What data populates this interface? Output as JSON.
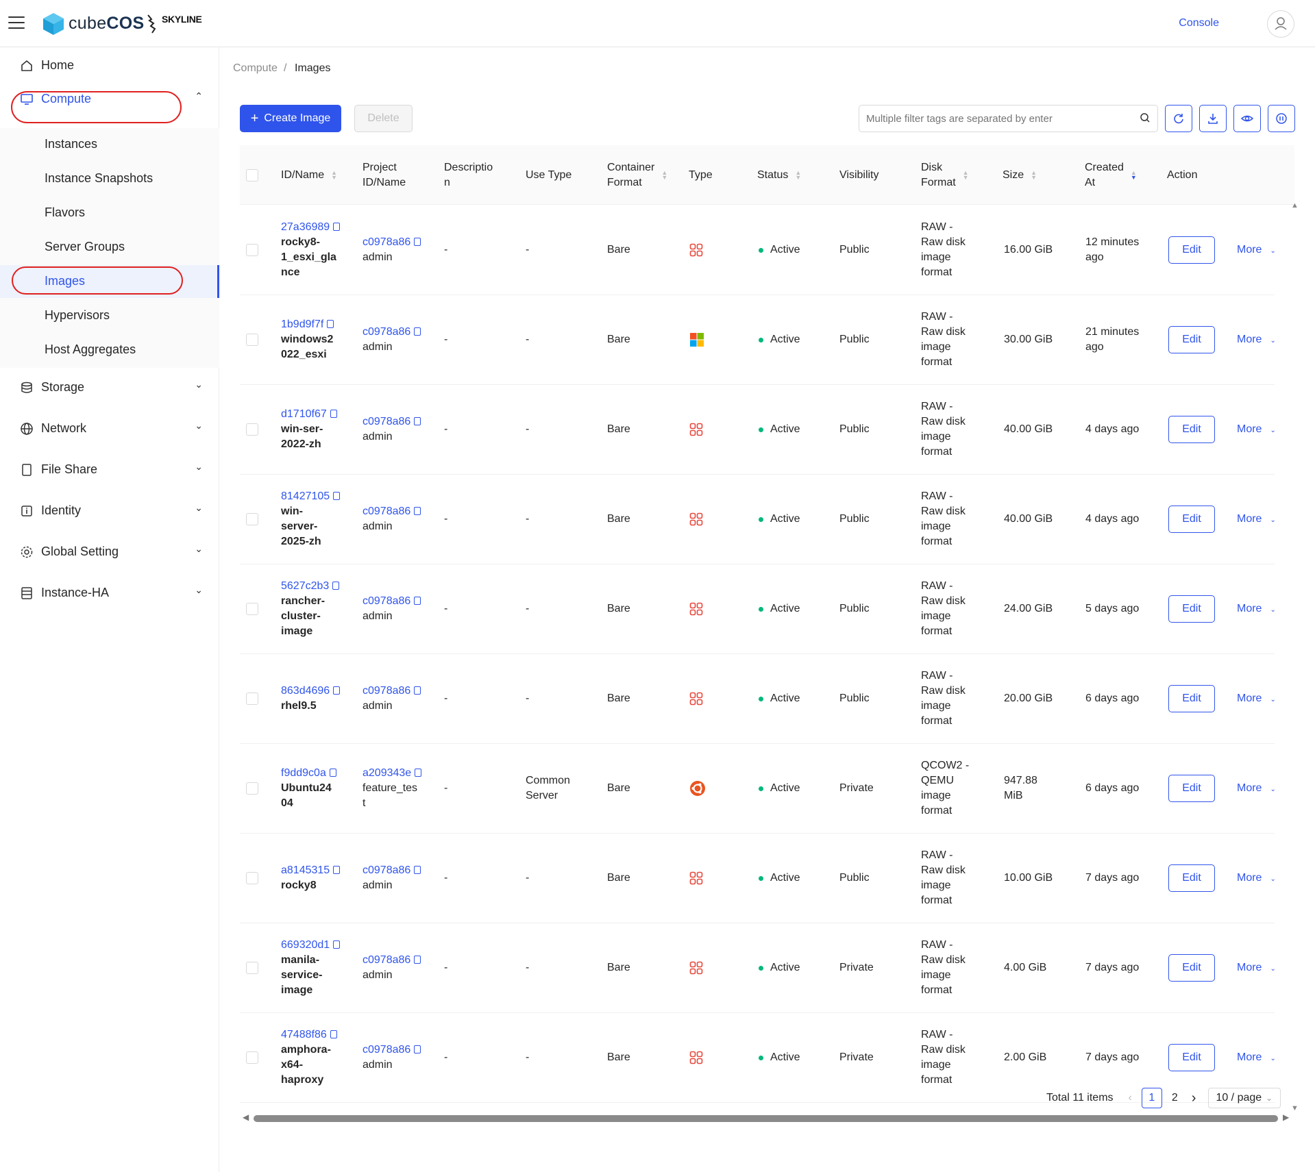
{
  "header": {
    "brand_light": "cube",
    "brand_bold": "COS",
    "partner": "SKYLINE",
    "console_label": "Console"
  },
  "sidebar": {
    "home": "Home",
    "compute": "Compute",
    "compute_children": [
      "Instances",
      "Instance Snapshots",
      "Flavors",
      "Server Groups",
      "Images",
      "Hypervisors",
      "Host Aggregates"
    ],
    "storage": "Storage",
    "network": "Network",
    "file_share": "File Share",
    "identity": "Identity",
    "global_setting": "Global Setting",
    "instance_ha": "Instance-HA",
    "active_item": "Images",
    "highlight_color": "#e02020"
  },
  "breadcrumb": {
    "parent": "Compute",
    "separator": "/",
    "current": "Images"
  },
  "toolbar": {
    "create_label": "Create Image",
    "delete_label": "Delete",
    "search_placeholder": "Multiple filter tags are separated by enter"
  },
  "columns": {
    "id_name": "ID/Name",
    "project_l1": "Project",
    "project_l2": "ID/Name",
    "desc_l1": "Descriptio",
    "desc_l2": "n",
    "use_type": "Use Type",
    "container_l1": "Container",
    "container_l2": "Format",
    "type": "Type",
    "status": "Status",
    "visibility": "Visibility",
    "disk_l1": "Disk",
    "disk_l2": "Format",
    "size": "Size",
    "created_l1": "Created",
    "created_l2": "At",
    "action": "Action"
  },
  "rows": [
    {
      "id": "27a36989",
      "name": [
        "rocky8-",
        "1_esxi_gla",
        "nce"
      ],
      "project_id": "c0978a86",
      "project": [
        "admin"
      ],
      "desc": "-",
      "use": [
        "-"
      ],
      "container": "Bare",
      "os": "generic",
      "status": "Active",
      "visibility": "Public",
      "disk": [
        "RAW -",
        "Raw disk",
        "image",
        "format"
      ],
      "size": [
        "16.00 GiB"
      ],
      "created": [
        "12 minutes",
        "ago"
      ],
      "edit": "Edit",
      "more": "More"
    },
    {
      "id": "1b9d9f7f",
      "name": [
        "windows2",
        "022_esxi"
      ],
      "project_id": "c0978a86",
      "project": [
        "admin"
      ],
      "desc": "-",
      "use": [
        "-"
      ],
      "container": "Bare",
      "os": "windows",
      "status": "Active",
      "visibility": "Public",
      "disk": [
        "RAW -",
        "Raw disk",
        "image",
        "format"
      ],
      "size": [
        "30.00 GiB"
      ],
      "created": [
        "21 minutes",
        "ago"
      ],
      "edit": "Edit",
      "more": "More"
    },
    {
      "id": "d1710f67",
      "name": [
        "win-ser-",
        "2022-zh"
      ],
      "project_id": "c0978a86",
      "project": [
        "admin"
      ],
      "desc": "-",
      "use": [
        "-"
      ],
      "container": "Bare",
      "os": "generic",
      "status": "Active",
      "visibility": "Public",
      "disk": [
        "RAW -",
        "Raw disk",
        "image",
        "format"
      ],
      "size": [
        "40.00 GiB"
      ],
      "created": [
        "4 days ago"
      ],
      "edit": "Edit",
      "more": "More"
    },
    {
      "id": "81427105",
      "name": [
        "win-",
        "server-",
        "2025-zh"
      ],
      "project_id": "c0978a86",
      "project": [
        "admin"
      ],
      "desc": "-",
      "use": [
        "-"
      ],
      "container": "Bare",
      "os": "generic",
      "status": "Active",
      "visibility": "Public",
      "disk": [
        "RAW -",
        "Raw disk",
        "image",
        "format"
      ],
      "size": [
        "40.00 GiB"
      ],
      "created": [
        "4 days ago"
      ],
      "edit": "Edit",
      "more": "More"
    },
    {
      "id": "5627c2b3",
      "name": [
        "rancher-",
        "cluster-",
        "image"
      ],
      "project_id": "c0978a86",
      "project": [
        "admin"
      ],
      "desc": "-",
      "use": [
        "-"
      ],
      "container": "Bare",
      "os": "generic",
      "status": "Active",
      "visibility": "Public",
      "disk": [
        "RAW -",
        "Raw disk",
        "image",
        "format"
      ],
      "size": [
        "24.00 GiB"
      ],
      "created": [
        "5 days ago"
      ],
      "edit": "Edit",
      "more": "More"
    },
    {
      "id": "863d4696",
      "name": [
        "rhel9.5"
      ],
      "project_id": "c0978a86",
      "project": [
        "admin"
      ],
      "desc": "-",
      "use": [
        "-"
      ],
      "container": "Bare",
      "os": "generic",
      "status": "Active",
      "visibility": "Public",
      "disk": [
        "RAW -",
        "Raw disk",
        "image",
        "format"
      ],
      "size": [
        "20.00 GiB"
      ],
      "created": [
        "6 days ago"
      ],
      "edit": "Edit",
      "more": "More"
    },
    {
      "id": "f9dd9c0a",
      "name": [
        "Ubuntu24",
        "04"
      ],
      "project_id": "a209343e",
      "project": [
        "feature_tes",
        "t"
      ],
      "desc": "-",
      "use": [
        "Common",
        "Server"
      ],
      "container": "Bare",
      "os": "ubuntu",
      "status": "Active",
      "visibility": "Private",
      "disk": [
        "QCOW2 -",
        "QEMU",
        "image",
        "format"
      ],
      "size": [
        "947.88",
        "MiB"
      ],
      "created": [
        "6 days ago"
      ],
      "edit": "Edit",
      "more": "More"
    },
    {
      "id": "a8145315",
      "name": [
        "rocky8"
      ],
      "project_id": "c0978a86",
      "project": [
        "admin"
      ],
      "desc": "-",
      "use": [
        "-"
      ],
      "container": "Bare",
      "os": "generic",
      "status": "Active",
      "visibility": "Public",
      "disk": [
        "RAW -",
        "Raw disk",
        "image",
        "format"
      ],
      "size": [
        "10.00 GiB"
      ],
      "created": [
        "7 days ago"
      ],
      "edit": "Edit",
      "more": "More"
    },
    {
      "id": "669320d1",
      "name": [
        "manila-",
        "service-",
        "image"
      ],
      "project_id": "c0978a86",
      "project": [
        "admin"
      ],
      "desc": "-",
      "use": [
        "-"
      ],
      "container": "Bare",
      "os": "generic",
      "status": "Active",
      "visibility": "Private",
      "disk": [
        "RAW -",
        "Raw disk",
        "image",
        "format"
      ],
      "size": [
        "4.00 GiB"
      ],
      "created": [
        "7 days ago"
      ],
      "edit": "Edit",
      "more": "More"
    },
    {
      "id": "47488f86",
      "name": [
        "amphora-",
        "x64-",
        "haproxy"
      ],
      "project_id": "c0978a86",
      "project": [
        "admin"
      ],
      "desc": "-",
      "use": [
        "-"
      ],
      "container": "Bare",
      "os": "generic",
      "status": "Active",
      "visibility": "Private",
      "disk": [
        "RAW -",
        "Raw disk",
        "image",
        "format"
      ],
      "size": [
        "2.00 GiB"
      ],
      "created": [
        "7 days ago"
      ],
      "edit": "Edit",
      "more": "More"
    }
  ],
  "pagination": {
    "total": "Total 11 items",
    "page1": "1",
    "page2": "2",
    "page_size": "10 / page"
  },
  "colors": {
    "primary": "#2f54eb",
    "status_active": "#00b87a",
    "os_icon": "#e8463a"
  }
}
